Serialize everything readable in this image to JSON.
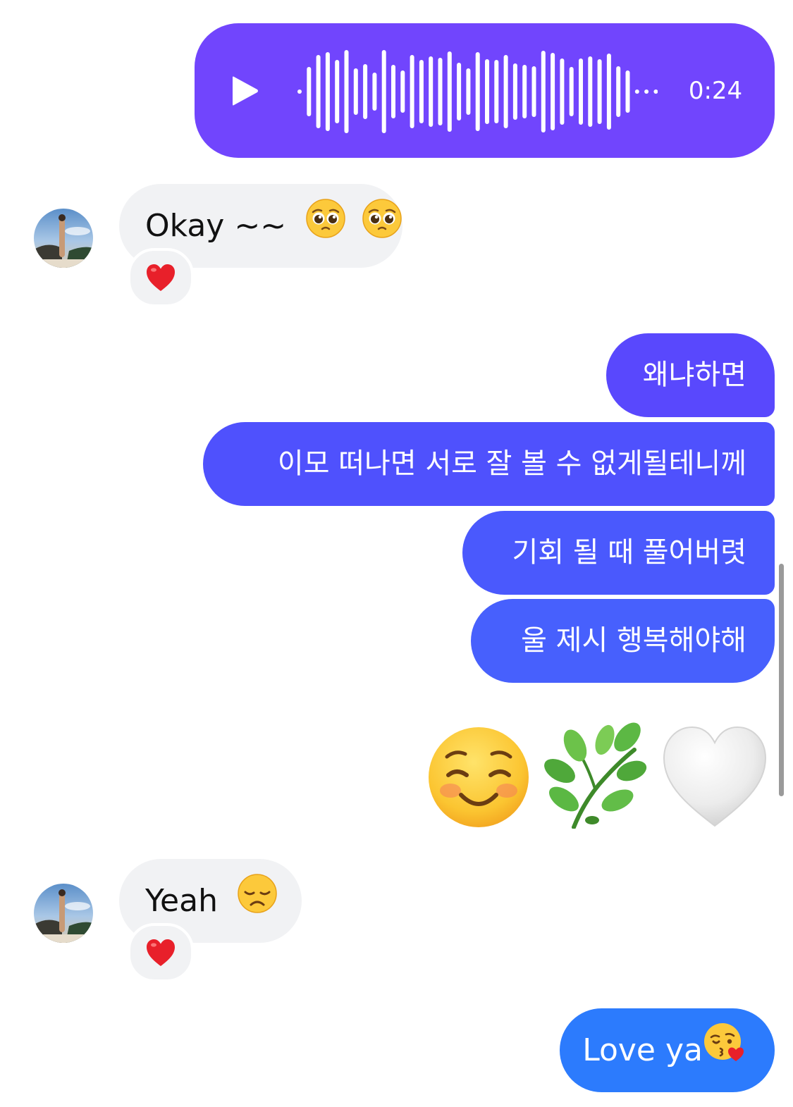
{
  "voice_message": {
    "duration": "0:24",
    "color": "#7145fd"
  },
  "messages": [
    {
      "id": "m1",
      "direction": "incoming",
      "text": "Okay ~~",
      "emoji": [
        "pleading-face",
        "pleading-face"
      ],
      "reaction": "red-heart"
    },
    {
      "id": "m2",
      "direction": "outgoing",
      "text": "왜냐하면"
    },
    {
      "id": "m3",
      "direction": "outgoing",
      "text": "이모 떠나면 서로 잘 볼 수 없게될테니께"
    },
    {
      "id": "m4",
      "direction": "outgoing",
      "text": "기회 될 때 풀어버렷"
    },
    {
      "id": "m5",
      "direction": "outgoing",
      "text": "울 제시 행복해야해"
    },
    {
      "id": "m6",
      "direction": "outgoing",
      "emoji_only": [
        "smiling-face",
        "herb",
        "white-heart"
      ]
    },
    {
      "id": "m7",
      "direction": "incoming",
      "text": "Yeah",
      "emoji": [
        "disappointed-face"
      ],
      "reaction": "red-heart"
    },
    {
      "id": "m8",
      "direction": "outgoing",
      "text": "Love ya",
      "emoji": [
        "face-blowing-kiss"
      ]
    }
  ],
  "colors": {
    "gradient_top": "#7145fd",
    "gradient_mid": "#4a5bfd",
    "gradient_bottom": "#2e7bfd",
    "incoming_bubble": "#f1f2f4"
  }
}
